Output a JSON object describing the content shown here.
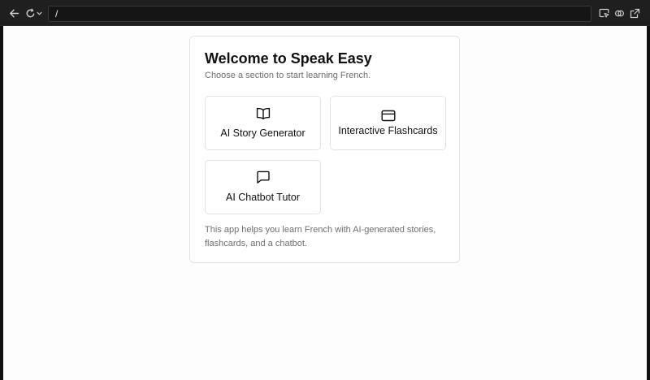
{
  "browser": {
    "url": "/",
    "icons": [
      "back-arrow-icon",
      "reload-icon",
      "chevron-down-icon",
      "inspect-icon",
      "link-icon",
      "open-external-icon"
    ]
  },
  "app": {
    "title": "Welcome to Speak Easy",
    "subtitle": "Choose a section to start learning French.",
    "sections": [
      {
        "label": "AI Story Generator",
        "icon": "book-open-icon"
      },
      {
        "label": "Interactive Flashcards",
        "icon": "flashcard-icon"
      },
      {
        "label": "AI Chatbot Tutor",
        "icon": "message-square-icon"
      }
    ],
    "description": "This app helps you learn French with AI-generated stories, flashcards, and a chatbot."
  },
  "colors": {
    "chrome_bg": "#1f1f1f",
    "page_bg": "#fdfdfd",
    "card_border": "#e3e3e3",
    "muted_text": "#6f6f6f"
  }
}
